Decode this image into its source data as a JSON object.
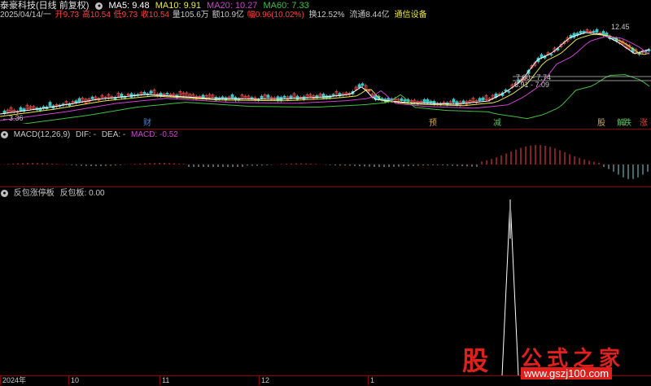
{
  "header": {
    "stock": "泰豪科技",
    "period": "(日线 前复权)",
    "ma5": "MA5: 9.48",
    "ma10": "MA10: 9.91",
    "ma20": "MA20: 10.27",
    "ma60": "MA60: 7.33",
    "date": "2025/04/14/一",
    "open": "开9.73",
    "high": "高10.54",
    "low": "低9.73",
    "close": "收10.54",
    "volume": "量105.6万",
    "amount": "额10.9亿",
    "change": "幅0.96(10.02%)",
    "turnover": "换12.52%",
    "float": "流通8.44亿",
    "industry": "通信设备"
  },
  "price_annotations": {
    "high_label": "12.45",
    "low_label": "3.36",
    "range1": "7.60 - 7.74",
    "range2": "6.91 - 7.09"
  },
  "event_markers": [
    {
      "label": "财",
      "color": "#4a7fd6"
    },
    {
      "label": "预",
      "color": "#d6a44a"
    },
    {
      "label": "减",
      "color": "#5cc05c"
    },
    {
      "label": "股",
      "color": "#d6a44a"
    },
    {
      "label": "解",
      "color": "#5cc05c"
    },
    {
      "label": "跌",
      "color": "#5cc05c"
    },
    {
      "label": "涨",
      "color": "#e04a4a"
    }
  ],
  "macd": {
    "title": "MACD(12,26,9)",
    "dif": "DIF: -",
    "dea": "DEA: -",
    "macd": "MACD: -0.52"
  },
  "indicator": {
    "title": "反包涨停板",
    "value": "反包板: 0.00"
  },
  "xaxis": [
    "2024年",
    "10",
    "11",
    "12",
    "1"
  ],
  "watermark": {
    "logo": "股",
    "name": "公式之家",
    "url": "www.gszj100.com"
  },
  "colors": {
    "ma5": "#ffffff",
    "ma10": "#e8e84a",
    "ma20": "#d040d0",
    "ma60": "#40c040",
    "up": "#ff4040",
    "down": "#40c0c0"
  }
}
